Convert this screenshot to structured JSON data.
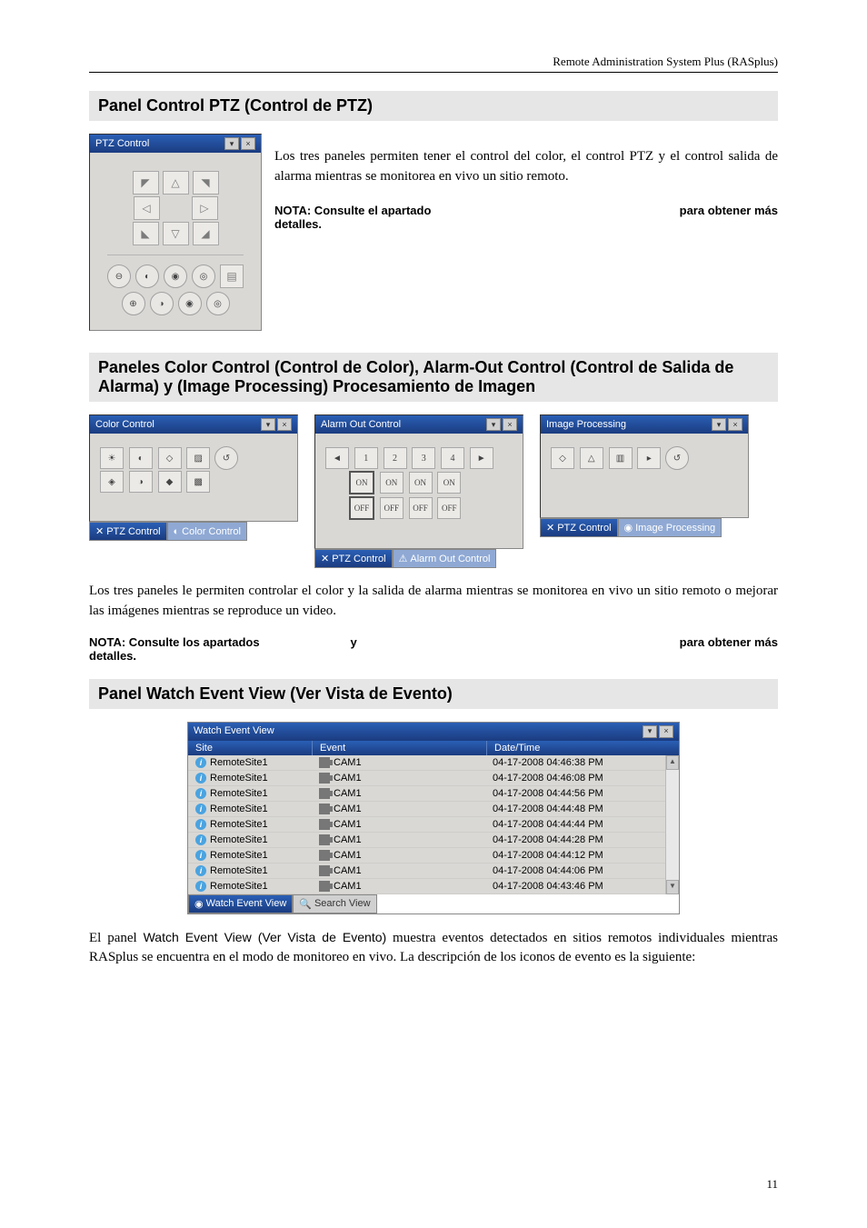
{
  "header": {
    "product": "Remote Administration System Plus (RASplus)"
  },
  "section1": {
    "title": "Panel Control PTZ (Control de PTZ)",
    "panel_title": "PTZ Control",
    "para1": "Los tres paneles permiten tener el control del color, el control PTZ y el control salida de alarma mientras se monitorea en vivo un sitio remoto.",
    "note_left": "NOTA: Consulte el apartado",
    "note_right": "para obtener más",
    "note_below": "detalles."
  },
  "section2": {
    "title": "Paneles Color Control (Control de Color), Alarm-Out Control (Control de Salida de Alarma) y (Image Processing) Procesamiento de Imagen",
    "panels": {
      "color": "Color Control",
      "alarm": "Alarm Out Control",
      "image": "Image Processing"
    },
    "tabs": {
      "ptz": "PTZ Control",
      "color": "Color Control",
      "alarm": "Alarm Out Control",
      "image": "Image Processing"
    },
    "alarm_nums": [
      "1",
      "2",
      "3",
      "4"
    ],
    "alarm_on": "ON",
    "alarm_off": "OFF",
    "para": "Los tres paneles le permiten controlar el color y la salida de alarma mientras se monitorea en vivo un sitio remoto o mejorar las imágenes mientras se reproduce un video.",
    "note_left": "NOTA: Consulte los apartados",
    "note_mid": "y",
    "note_right": "para obtener más",
    "note_below": "detalles."
  },
  "section3": {
    "title": "Panel Watch Event View (Ver Vista de Evento)",
    "wev_title": "Watch Event View",
    "cols": {
      "c1": "Site",
      "c2": "Event",
      "c3": "Date/Time"
    },
    "rows": [
      {
        "site": "RemoteSite1",
        "event": "CAM1",
        "dt": "04-17-2008  04:46:38 PM"
      },
      {
        "site": "RemoteSite1",
        "event": "CAM1",
        "dt": "04-17-2008  04:46:08 PM"
      },
      {
        "site": "RemoteSite1",
        "event": "CAM1",
        "dt": "04-17-2008  04:44:56 PM"
      },
      {
        "site": "RemoteSite1",
        "event": "CAM1",
        "dt": "04-17-2008  04:44:48 PM"
      },
      {
        "site": "RemoteSite1",
        "event": "CAM1",
        "dt": "04-17-2008  04:44:44 PM"
      },
      {
        "site": "RemoteSite1",
        "event": "CAM1",
        "dt": "04-17-2008  04:44:28 PM"
      },
      {
        "site": "RemoteSite1",
        "event": "CAM1",
        "dt": "04-17-2008  04:44:12 PM"
      },
      {
        "site": "RemoteSite1",
        "event": "CAM1",
        "dt": "04-17-2008  04:44:06 PM"
      },
      {
        "site": "RemoteSite1",
        "event": "CAM1",
        "dt": "04-17-2008  04:43:46 PM"
      }
    ],
    "tabs": {
      "w": "Watch Event View",
      "s": "Search View"
    },
    "para_pre": "El panel ",
    "para_f": "Watch Event View (Ver Vista de Evento)",
    "para_post": " muestra eventos detectados en sitios remotos individuales mientras RASplus se encuentra en el modo de monitoreo en vivo. La descripción de los iconos de evento es la siguiente:"
  },
  "page_number": "11"
}
